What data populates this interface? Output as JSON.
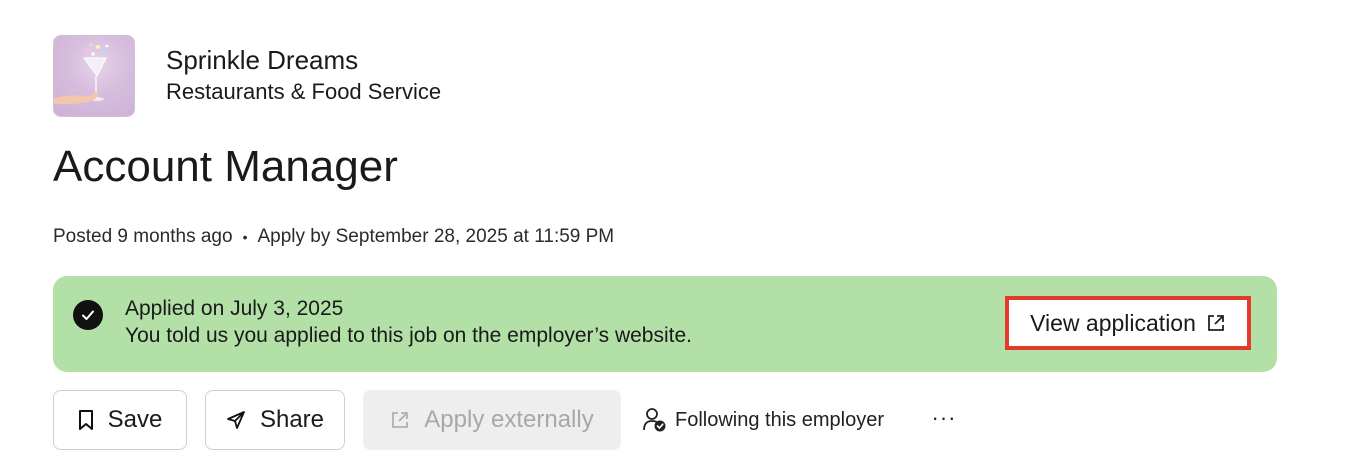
{
  "employer": {
    "name": "Sprinkle Dreams",
    "industry": "Restaurants & Food Service",
    "logo_icon": "cocktail-glass-photo"
  },
  "job": {
    "title": "Account Manager",
    "posted": "Posted 9 months ago",
    "separator": "•",
    "apply_by": "Apply by September 28, 2025 at 11:59 PM"
  },
  "banner": {
    "bg_color": "#b2e0a6",
    "icon": "check-circle-icon",
    "title": "Applied on July 3, 2025",
    "text": "You told us you applied to this job on the employer’s website.",
    "view_button": "View application",
    "view_button_icon": "external-link-icon",
    "highlight_color": "#e23a2d"
  },
  "actions": {
    "save": "Save",
    "share": "Share",
    "apply_externally": "Apply externally",
    "following": "Following this employer",
    "more": "···"
  }
}
